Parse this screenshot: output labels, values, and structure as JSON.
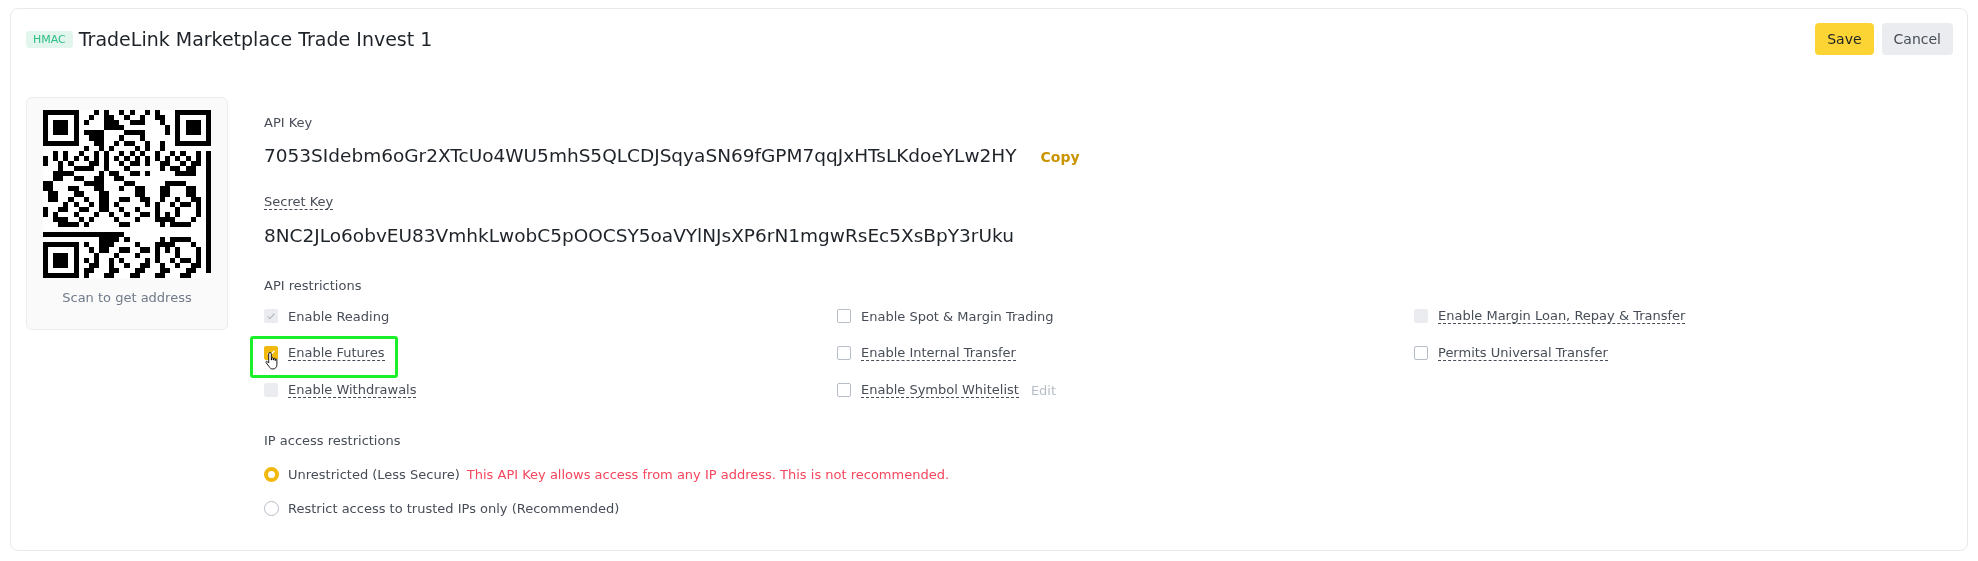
{
  "header": {
    "badge": "HMAC",
    "title": "TradeLink Marketplace Trade Invest 1",
    "buttons": [
      {
        "label": "Save",
        "kind": "primary"
      },
      {
        "label": "Cancel",
        "kind": "secondary"
      }
    ]
  },
  "qr": {
    "caption": "Scan to get address"
  },
  "api_key": {
    "label": "API Key",
    "dotted": false,
    "value": "7053SIdebm6oGr2XTcUo4WU5mhS5QLCDJSqyaSN69fGPM7qqJxHTsLKdoeYLw2HY",
    "action": "Copy"
  },
  "secret_key": {
    "label": "Secret Key",
    "dotted": true,
    "value": "8NC2JLo6obvEU83VmhkLwobC5pOOCSY5oaVYlNJsXP6rN1mgwRsEc5XsBpY3rUku"
  },
  "restrictions": {
    "title": "API restrictions",
    "items": [
      {
        "label": "Enable Reading",
        "checked": true,
        "disabled": true,
        "dotted": false,
        "highlighted": false
      },
      {
        "label": "Enable Spot & Margin Trading",
        "checked": false,
        "disabled": false,
        "dotted": false,
        "highlighted": false
      },
      {
        "label": "Enable Margin Loan, Repay & Transfer",
        "checked": false,
        "disabled": true,
        "dotted": true,
        "highlighted": false
      },
      {
        "label": "Enable Futures",
        "checked": true,
        "disabled": false,
        "dotted": true,
        "highlighted": true
      },
      {
        "label": "Enable Internal Transfer",
        "checked": false,
        "disabled": false,
        "dotted": true,
        "highlighted": false
      },
      {
        "label": "Permits Universal Transfer",
        "checked": false,
        "disabled": false,
        "dotted": true,
        "highlighted": false
      },
      {
        "label": "Enable Withdrawals",
        "checked": false,
        "disabled": true,
        "dotted": true,
        "highlighted": false
      },
      {
        "label": "Enable Symbol Whitelist",
        "checked": false,
        "disabled": false,
        "dotted": true,
        "highlighted": false,
        "action": "Edit"
      }
    ]
  },
  "ip_restrictions": {
    "title": "IP access restrictions",
    "options": [
      {
        "label": "Unrestricted (Less Secure)",
        "selected": true,
        "warning": "This API Key allows access from any IP address. This is not recommended."
      },
      {
        "label": "Restrict access to trusted IPs only (Recommended)",
        "selected": false
      }
    ]
  }
}
